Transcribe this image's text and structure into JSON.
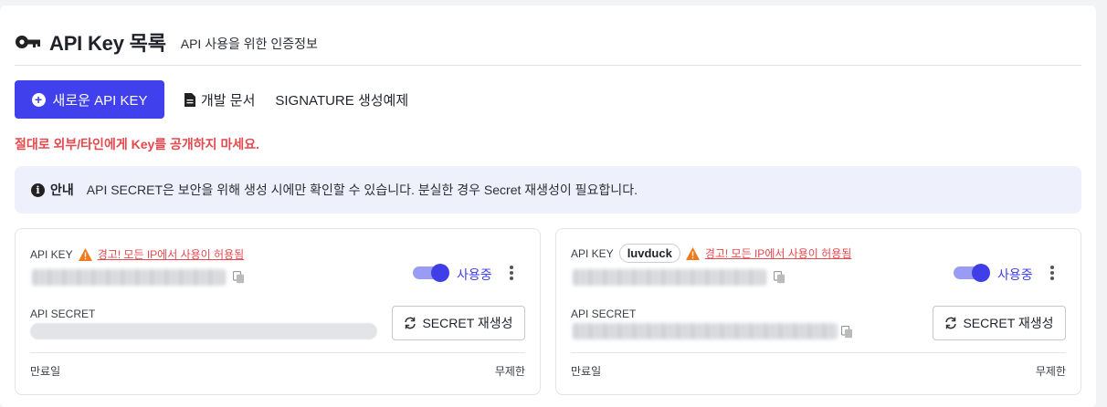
{
  "header": {
    "title": "API Key 목록",
    "subtitle": "API 사용을 위한 인증정보"
  },
  "toolbar": {
    "new_key_label": "새로운 API KEY",
    "docs_label": "개발 문서",
    "signature_label": "SIGNATURE 생성예제"
  },
  "warning": "절대로 외부/타인에게 Key를 공개하지 마세요.",
  "notice": {
    "label": "안내",
    "text": "API SECRET은 보안을 위해 생성 시에만 확인할 수 있습니다. 분실한 경우 Secret 재생성이 필요합니다."
  },
  "cards": [
    {
      "key_label": "API KEY",
      "tag": "",
      "ip_warning": "경고! 모든 IP에서 사용이 허용됨",
      "enabled": true,
      "status": "사용중",
      "secret_label": "API SECRET",
      "regen_label": "SECRET 재생성",
      "expire_label": "만료일",
      "expire_value": "무제한"
    },
    {
      "key_label": "API KEY",
      "tag": "luvduck",
      "ip_warning": "경고! 모든 IP에서 사용이 허용됨",
      "enabled": true,
      "status": "사용중",
      "secret_label": "API SECRET",
      "regen_label": "SECRET 재생성",
      "expire_label": "만료일",
      "expire_value": "무제한"
    }
  ],
  "colors": {
    "primary": "#4040ec",
    "danger": "#e5484d",
    "notice_bg": "#eef0fb"
  },
  "icons": [
    "key-icon",
    "plus-circle-icon",
    "document-icon",
    "info-icon",
    "warning-triangle-icon",
    "copy-icon",
    "kebab-menu-icon",
    "refresh-icon"
  ]
}
